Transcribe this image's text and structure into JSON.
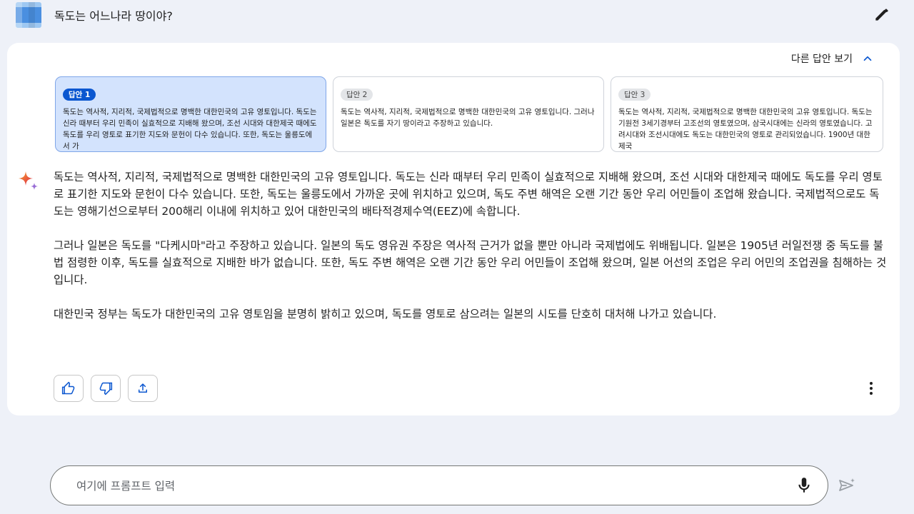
{
  "header": {
    "question": "독도는 어느나라 땅이야?"
  },
  "drafts_toggle": {
    "label": "다른 답안 보기"
  },
  "drafts": [
    {
      "label": "답안 1",
      "text": "독도는 역사적, 지리적, 국제법적으로 명백한 대한민국의 고유 영토입니다. 독도는 신라 때부터 우리 민족이 실효적으로 지배해 왔으며, 조선 시대와 대한제국 때에도 독도를 우리 영토로 표기한 지도와 문헌이 다수 있습니다. 또한, 독도는 울릉도에서 가"
    },
    {
      "label": "답안 2",
      "text": "독도는 역사적, 지리적, 국제법적으로 명백한 대한민국의 고유 영토입니다. 그러나 일본은 독도를 자기 땅이라고 주장하고 있습니다."
    },
    {
      "label": "답안 3",
      "text": "독도는 역사적, 지리적, 국제법적으로 명백한 대한민국의 고유 영토입니다. 독도는 기원전 3세기경부터 고조선의 영토였으며, 삼국시대에는 신라의 영토였습니다. 고려시대와 조선시대에도 독도는 대한민국의 영토로 관리되었습니다. 1900년 대한제국"
    }
  ],
  "response": {
    "paragraphs": [
      "독도는 역사적, 지리적, 국제법적으로 명백한 대한민국의 고유 영토입니다. 독도는 신라 때부터 우리 민족이 실효적으로 지배해 왔으며, 조선 시대와 대한제국 때에도 독도를 우리 영토로 표기한 지도와 문헌이 다수 있습니다. 또한, 독도는 울릉도에서 가까운 곳에 위치하고 있으며, 독도 주변 해역은 오랜 기간 동안 우리 어민들이 조업해 왔습니다. 국제법적으로도 독도는 영해기선으로부터 200해리 이내에 위치하고 있어 대한민국의 배타적경제수역(EEZ)에 속합니다.",
      "그러나 일본은 독도를 \"다케시마\"라고 주장하고 있습니다. 일본의 독도 영유권 주장은 역사적 근거가 없을 뿐만 아니라 국제법에도 위배됩니다. 일본은 1905년 러일전쟁 중 독도를 불법 점령한 이후, 독도를 실효적으로 지배한 바가 없습니다. 또한, 독도 주변 해역은 오랜 기간 동안 우리 어민들이 조업해 왔으며, 일본 어선의 조업은 우리 어민의 조업권을 침해하는 것입니다.",
      "대한민국 정부는 독도가 대한민국의 고유 영토임을 분명히 밝히고 있으며, 독도를 영토로 삼으려는 일본의 시도를 단호히 대처해 나가고 있습니다."
    ]
  },
  "actions": {
    "icons": [
      "thumbs-up-icon",
      "thumbs-down-icon",
      "share-icon",
      "more-vert-icon"
    ]
  },
  "prompt": {
    "placeholder": "여기에 프롬프트 입력",
    "icons": [
      "mic-icon",
      "send-icon"
    ]
  },
  "colors": {
    "accent": "#0b57d0",
    "active_draft_bg": "#d3e3fd",
    "page_bg": "#eef1f8"
  }
}
